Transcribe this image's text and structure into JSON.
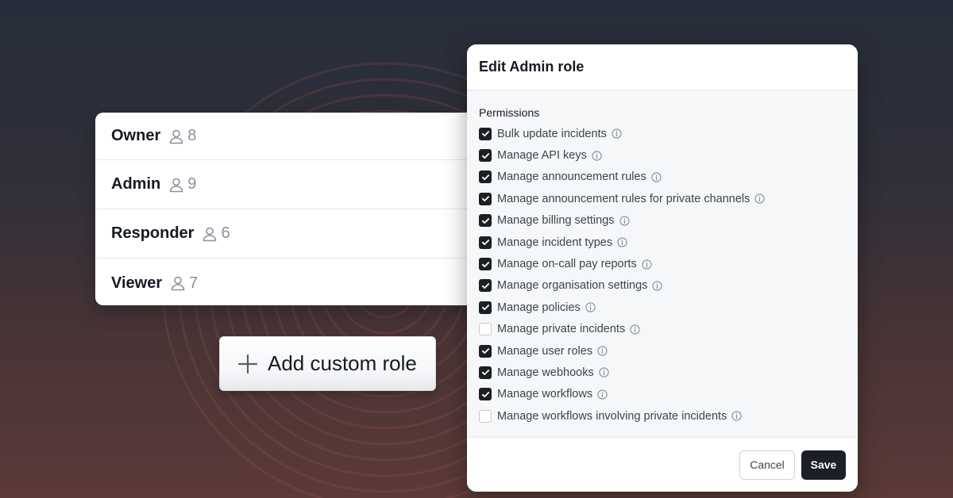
{
  "roles": [
    {
      "name": "Owner",
      "count": "8"
    },
    {
      "name": "Admin",
      "count": "9"
    },
    {
      "name": "Responder",
      "count": "6"
    },
    {
      "name": "Viewer",
      "count": "7"
    }
  ],
  "add_role_label": "Add custom role",
  "modal": {
    "title": "Edit Admin role",
    "permissions_heading": "Permissions",
    "permissions": [
      {
        "label": "Bulk update incidents",
        "checked": true
      },
      {
        "label": "Manage API keys",
        "checked": true
      },
      {
        "label": "Manage announcement rules",
        "checked": true
      },
      {
        "label": "Manage announcement rules for private channels",
        "checked": true
      },
      {
        "label": "Manage billing settings",
        "checked": true
      },
      {
        "label": "Manage incident types",
        "checked": true
      },
      {
        "label": "Manage on-call pay reports",
        "checked": true
      },
      {
        "label": "Manage organisation settings",
        "checked": true
      },
      {
        "label": "Manage policies",
        "checked": true
      },
      {
        "label": "Manage private incidents",
        "checked": false
      },
      {
        "label": "Manage user roles",
        "checked": true
      },
      {
        "label": "Manage webhooks",
        "checked": true
      },
      {
        "label": "Manage workflows",
        "checked": true
      },
      {
        "label": "Manage workflows involving private incidents",
        "checked": false
      }
    ],
    "cancel_label": "Cancel",
    "save_label": "Save"
  },
  "colors": {
    "accent": "#1b1f28",
    "ring": "#c0634f"
  },
  "icons": {
    "role_count": "user-icon",
    "add": "plus-icon",
    "info": "info-icon",
    "check": "check-icon"
  }
}
